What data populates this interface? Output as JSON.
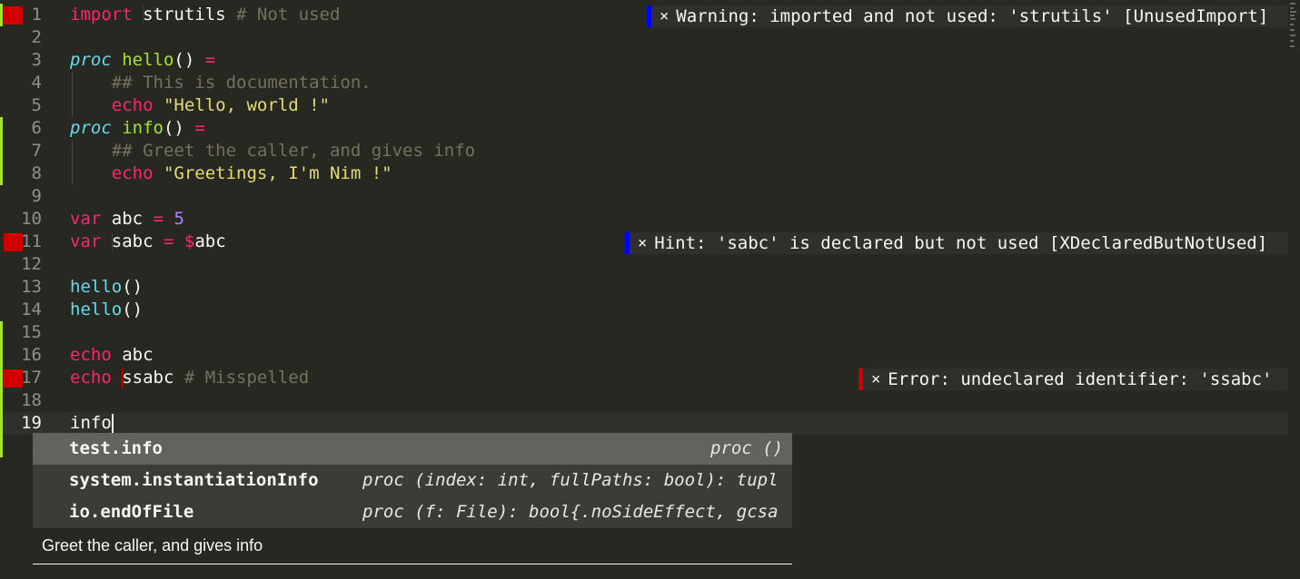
{
  "editor": {
    "lines": {
      "l1": {
        "num": "1",
        "t1": "import",
        "t2": "strutils",
        "t3": " # Not used"
      },
      "l2": {
        "num": "2"
      },
      "l3": {
        "num": "3",
        "t1": "proc",
        "t2": " ",
        "t3": "hello",
        "t4": "()",
        "t5": " ="
      },
      "l4": {
        "num": "4",
        "t1": "    ## This is documentation."
      },
      "l5": {
        "num": "5",
        "t1": "    echo",
        "t2": " \"Hello, world !\""
      },
      "l6": {
        "num": "6",
        "t1": "proc",
        "t2": " ",
        "t3": "info",
        "t4": "()",
        "t5": " ="
      },
      "l7": {
        "num": "7",
        "t1": "    ## Greet the caller, and gives info"
      },
      "l8": {
        "num": "8",
        "t1": "    echo",
        "t2": " \"Greetings, I'm Nim !\""
      },
      "l9": {
        "num": "9"
      },
      "l10": {
        "num": "10",
        "t1": "var",
        "t2": " abc ",
        "t3": "=",
        "t4": " ",
        "t5": "5"
      },
      "l11": {
        "num": "11",
        "t1": "var",
        "t2": " ",
        "t3": "sabc ",
        "t4": "=",
        "t5": " ",
        "t6": "$",
        "t7": "abc"
      },
      "l12": {
        "num": "12"
      },
      "l13": {
        "num": "13",
        "t1": "hello",
        "t2": "()"
      },
      "l14": {
        "num": "14",
        "t1": "hello",
        "t2": "()"
      },
      "l15": {
        "num": "15"
      },
      "l16": {
        "num": "16",
        "t1": "echo",
        "t2": " abc"
      },
      "l17": {
        "num": "17",
        "t1": "echo",
        "t2": " ",
        "t3": "ssabc",
        "t4": " # Misspelled"
      },
      "l18": {
        "num": "18"
      },
      "l19": {
        "num": "19",
        "t1": "info"
      },
      "l20": {
        "num": "2"
      }
    },
    "diagnostics": {
      "warning": {
        "close": "×",
        "text": "Warning: imported and not used: 'strutils' [UnusedImport]",
        "color": "#0000ff"
      },
      "hint": {
        "close": "×",
        "text": "Hint: 'sabc' is declared but not used [XDeclaredButNotUsed]",
        "color": "#0000ff"
      },
      "error": {
        "close": "×",
        "text": "Error: undeclared identifier: 'ssabc'",
        "color": "#d10000"
      }
    }
  },
  "autocomplete": {
    "items": [
      {
        "name": "test.info",
        "signature": "proc ()"
      },
      {
        "name": "system.instantiationInfo",
        "signature": "proc (index: int, fullPaths: bool): tupl"
      },
      {
        "name": "io.endOfFile",
        "signature": "proc (f: File): bool{.noSideEffect, gcsa"
      }
    ],
    "doc": "Greet the caller, and gives info"
  },
  "colors": {
    "background": "#272822",
    "keyword": "#f92672",
    "storage": "#66d9ef",
    "function": "#a6e22e",
    "string": "#e6db74",
    "number": "#ae81ff",
    "comment": "#75715e",
    "error_marker": "#d10000",
    "modified_bar": "#a6e22e"
  }
}
